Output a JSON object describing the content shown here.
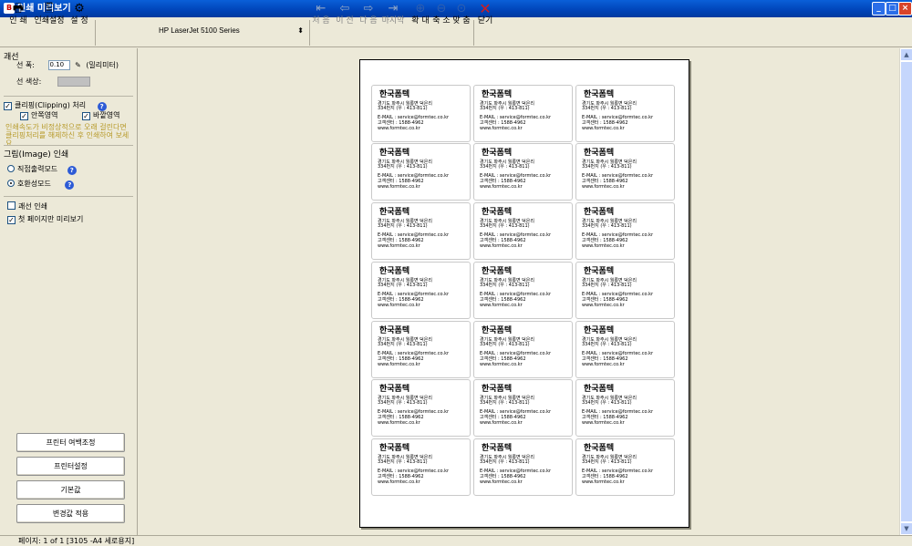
{
  "window": {
    "title": "인쇄 미리보기",
    "min": "_",
    "max": "□",
    "close": "×"
  },
  "toolbar": {
    "print": "인 쇄",
    "print_settings": "인쇄설정",
    "settings": "설 정",
    "printer": "HP LaserJet 5100 Series",
    "first": "처 음",
    "prev": "이 전",
    "next": "다 음",
    "last": "마지막",
    "zoom_in": "확 대",
    "zoom_out": "축 소",
    "fit": "맞 춤",
    "close": "닫기"
  },
  "left": {
    "line_section": "괘선",
    "line_width_label": "선 폭:",
    "line_width_value": "0.10",
    "line_width_unit": "(밀리미터)",
    "line_color_label": "선 색상:",
    "clipping_label": "클리핑(Clipping) 처리",
    "inside_label": "안쪽영역",
    "outside_label": "바깥영역",
    "warning": "인쇄속도가 비정상적으로 오래 걸린다면 클리핑처리를 해제하신 후 인쇄하여 보세요",
    "image_section": "그림(Image) 인쇄",
    "direct_mode": "직접출력모드",
    "compat_mode": "호환성모드",
    "grid_print": "괘선 인쇄",
    "first_page_only": "첫 페이지만 미리보기",
    "btn_margin": "프린터 여백조정",
    "btn_printer": "프린터설정",
    "btn_default": "기본값",
    "btn_apply": "변경값 적용"
  },
  "card": {
    "company": "한국폼텍",
    "address": "경기도 파주시 월롱면 덕은리",
    "zip": "334번지 (우 : 413-811)",
    "email": "E-MAIL : service@formtec.co.kr",
    "tel": "고객센터 : 1588-4962",
    "web": "www.formtec.co.kr"
  },
  "status": "페이지: 1 of 1  [3105 -A4 세로용지]"
}
